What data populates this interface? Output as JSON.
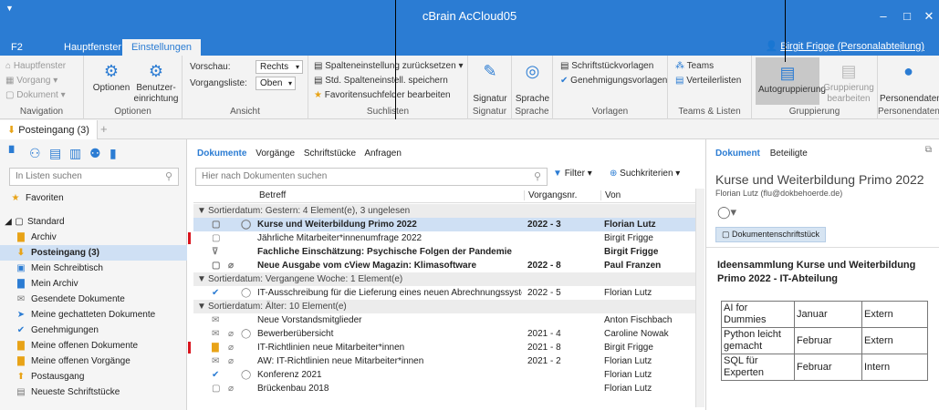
{
  "window": {
    "title": "cBrain AcCloud05",
    "minimize": "–",
    "maximize": "□",
    "close": "✕"
  },
  "tabs": {
    "f2": "F2",
    "hauptfenster": "Hauptfenster",
    "einstellungen": "Einstellungen"
  },
  "user": "Birgit Frigge (Personalabteilung)",
  "ribbon": {
    "navigation": {
      "label": "Navigation",
      "items": [
        "Hauptfenster",
        "Vorgang",
        "Dokument"
      ]
    },
    "optionen": {
      "label": "Optionen",
      "optionen": "Optionen",
      "benutzer": "Benutzer-\neinrichtung"
    },
    "ansicht": {
      "label": "Ansicht",
      "vorschau": "Vorschau:",
      "vorschau_val": "Rechts",
      "vorgangsliste": "Vorgangsliste:",
      "vorgangsliste_val": "Oben"
    },
    "suchlisten": {
      "label": "Suchlisten",
      "items": [
        "Spalteneinstellung zurücksetzen",
        "Std. Spalteneinstell. speichern",
        "Favoritensuchfelder bearbeiten"
      ]
    },
    "signatur": {
      "label": "Signatur",
      "btn": "Signatur"
    },
    "sprache": {
      "label": "Sprache",
      "btn": "Sprache"
    },
    "vorlagen": {
      "label": "Vorlagen",
      "items": [
        "Schriftstückvorlagen",
        "Genehmigungsvorlagen"
      ]
    },
    "teams": {
      "label": "Teams & Listen",
      "items": [
        "Teams",
        "Verteilerlisten"
      ]
    },
    "gruppierung": {
      "label": "Gruppierung",
      "auto": "Autogruppierung",
      "bearbeiten": "Gruppierung\nbearbeiten"
    },
    "personendaten": {
      "label": "Personendaten",
      "btn": "Personendaten"
    }
  },
  "doctab": {
    "label": "Posteingang (3)",
    "plus": "+"
  },
  "sidebar": {
    "search_placeholder": "In Listen suchen",
    "favoriten": "Favoriten",
    "standard": "Standard",
    "items": [
      {
        "label": "Archiv",
        "icon": "archive-icon"
      },
      {
        "label": "Posteingang (3)",
        "icon": "inbox-icon",
        "selected": true
      },
      {
        "label": "Mein Schreibtisch",
        "icon": "desk-icon"
      },
      {
        "label": "Mein Archiv",
        "icon": "archive-icon"
      },
      {
        "label": "Gesendete Dokumente",
        "icon": "sent-icon"
      },
      {
        "label": "Meine gechatteten Dokumente",
        "icon": "chat-icon"
      },
      {
        "label": "Genehmigungen",
        "icon": "check-icon"
      },
      {
        "label": "Meine offenen Dokumente",
        "icon": "doc-icon"
      },
      {
        "label": "Meine offenen Vorgänge",
        "icon": "folder-icon"
      },
      {
        "label": "Postausgang",
        "icon": "outbox-icon"
      },
      {
        "label": "Neueste Schriftstücke",
        "icon": "doc-icon"
      }
    ]
  },
  "center": {
    "tabs": [
      "Dokumente",
      "Vorgänge",
      "Schriftstücke",
      "Anfragen"
    ],
    "search_placeholder": "Hier nach Dokumenten suchen",
    "filter": "Filter",
    "suchkriterien": "Suchkriterien",
    "columns": {
      "betreff": "Betreff",
      "vorgangsnr": "Vorgangsnr.",
      "von": "Von"
    },
    "groups": [
      "Sortierdatum: Gestern: 4 Element(e), 3 ungelesen",
      "Sortierdatum: Vergangene Woche: 1 Element(e)",
      "Sortierdatum: Älter: 10 Element(e)"
    ],
    "rows": [
      {
        "betreff": "Kurse und Weiterbildung Primo 2022",
        "nr": "2022 - 3",
        "von": "Florian Lutz"
      },
      {
        "betreff": "Jährliche Mitarbeiter*innenumfrage 2022",
        "nr": "",
        "von": "Birgit Frigge"
      },
      {
        "betreff": "Fachliche Einschätzung: Psychische Folgen der Pandemie",
        "nr": "",
        "von": "Birgit Frigge"
      },
      {
        "betreff": "Neue Ausgabe vom cView Magazin: Klimasoftware",
        "nr": "2022 - 8",
        "von": "Paul Franzen"
      },
      {
        "betreff": "IT-Ausschreibung für die Lieferung eines neuen Abrechnungssystems: A...",
        "nr": "2022 - 5",
        "von": "Florian Lutz"
      },
      {
        "betreff": "Neue Vorstandsmitglieder",
        "nr": "",
        "von": "Anton Fischbach"
      },
      {
        "betreff": "Bewerberübersicht",
        "nr": "2021 - 4",
        "von": "Caroline Nowak"
      },
      {
        "betreff": "IT-Richtlinien neue Mitarbeiter*innen",
        "nr": "2021 - 8",
        "von": "Birgit Frigge"
      },
      {
        "betreff": "AW: IT-Richtlinien neue Mitarbeiter*innen",
        "nr": "2021 - 2",
        "von": "Florian Lutz"
      },
      {
        "betreff": "Konferenz 2021",
        "nr": "",
        "von": "Florian Lutz"
      },
      {
        "betreff": "Brückenbau 2018",
        "nr": "",
        "von": "Florian Lutz"
      }
    ]
  },
  "preview": {
    "tabs": [
      "Dokument",
      "Beteiligte"
    ],
    "title": "Kurse und Weiterbildung Primo 2022",
    "sender": "Florian Lutz (flu@dokbehoerde.de)",
    "badge": "Dokumentenschriftstück",
    "heading": "Ideensammlung Kurse und Weiterbildung Primo 2022 - IT-Abteilung",
    "table": [
      [
        "AI for Dummies",
        "Januar",
        "Extern"
      ],
      [
        "Python leicht gemacht",
        "Februar",
        "Extern"
      ],
      [
        "SQL für Experten",
        "Februar",
        "Intern"
      ]
    ]
  }
}
